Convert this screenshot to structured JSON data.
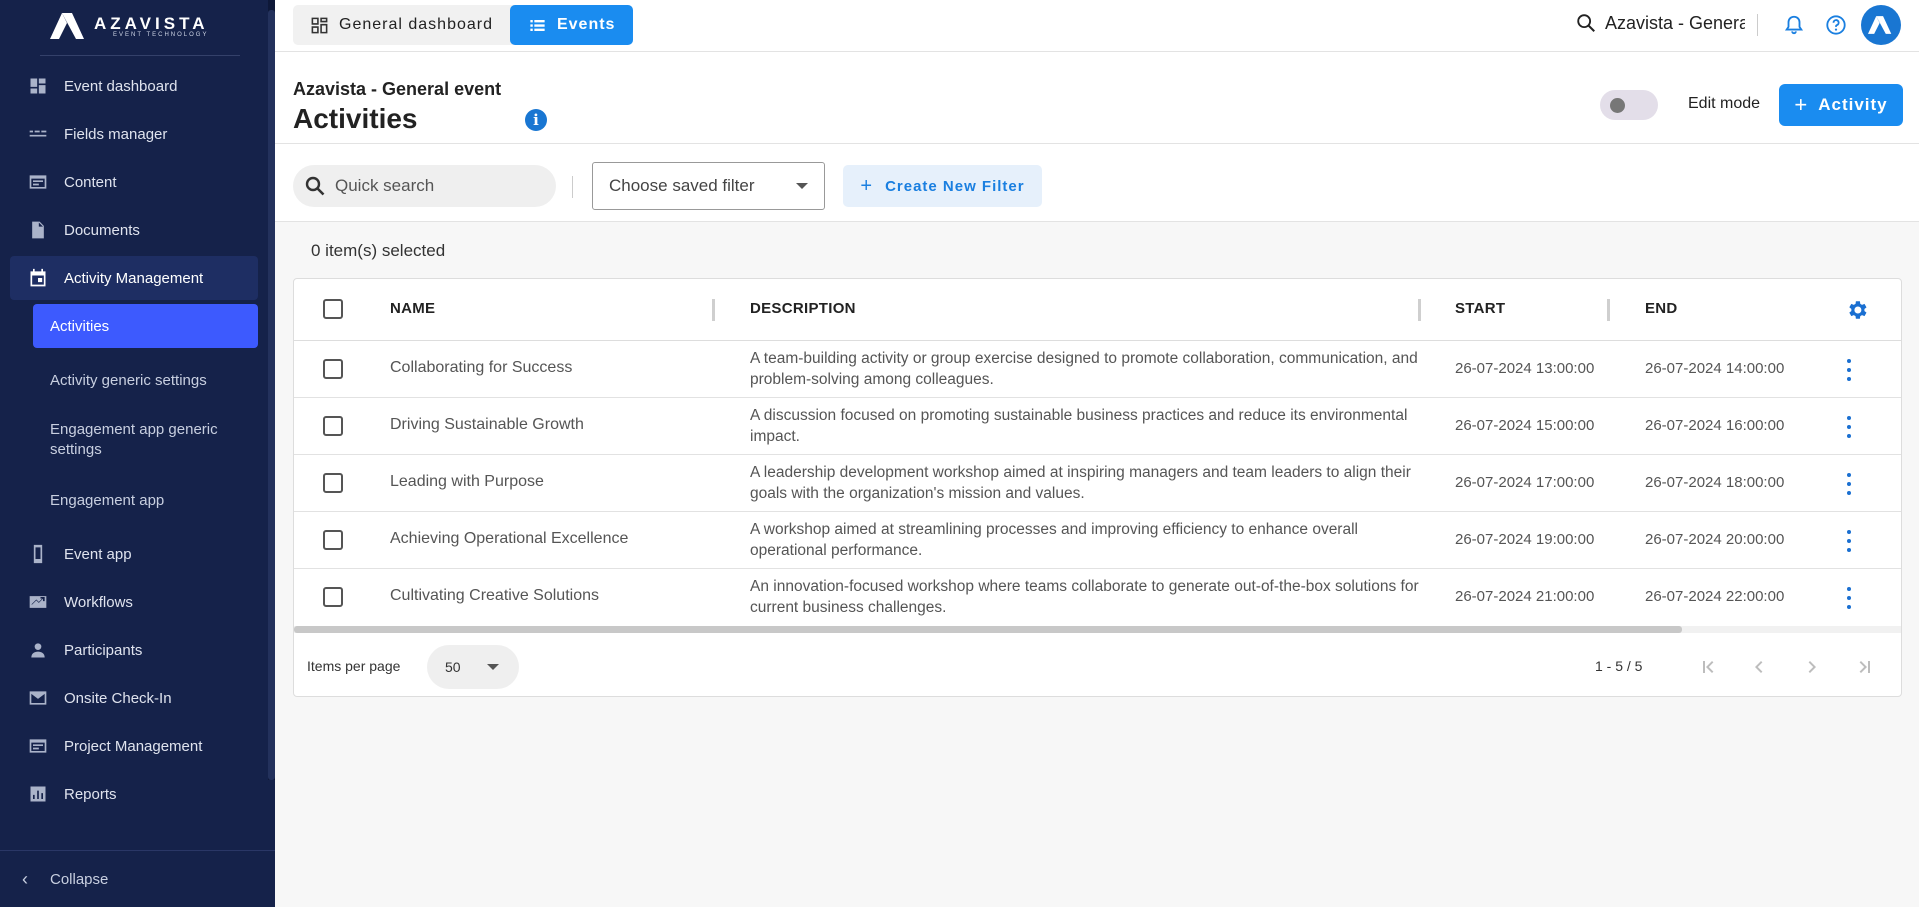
{
  "brand": {
    "name": "AZAVISTA",
    "tagline": "EVENT TECHNOLOGY"
  },
  "sidebar": {
    "items": [
      {
        "label": "Event dashboard",
        "icon": "dashboard-icon"
      },
      {
        "label": "Fields manager",
        "icon": "fields-icon"
      },
      {
        "label": "Content",
        "icon": "content-icon"
      },
      {
        "label": "Documents",
        "icon": "document-icon"
      },
      {
        "label": "Activity Management",
        "icon": "calendar-icon",
        "active": true
      },
      {
        "label": "Event app",
        "icon": "phone-icon"
      },
      {
        "label": "Workflows",
        "icon": "workflow-icon"
      },
      {
        "label": "Participants",
        "icon": "person-icon"
      },
      {
        "label": "Onsite Check-In",
        "icon": "mail-icon"
      },
      {
        "label": "Project Management",
        "icon": "project-icon"
      },
      {
        "label": "Reports",
        "icon": "reports-icon"
      }
    ],
    "sub_items": [
      {
        "label": "Activities",
        "active": true
      },
      {
        "label": "Activity generic settings"
      },
      {
        "label": "Engagement app generic settings"
      },
      {
        "label": "Engagement app"
      }
    ],
    "collapse_label": "Collapse"
  },
  "topbar": {
    "tabs": [
      {
        "label": "General dashboard",
        "icon": "grid-icon"
      },
      {
        "label": "Events",
        "icon": "list-icon",
        "active": true
      }
    ],
    "search_text": "Azavista - General event"
  },
  "header": {
    "event_name": "Azavista - General event",
    "title": "Activities",
    "edit_mode_label": "Edit mode",
    "edit_mode_on": false,
    "add_button_label": "Activity"
  },
  "filters": {
    "quick_search_placeholder": "Quick search",
    "saved_filter_placeholder": "Choose saved filter",
    "create_filter_label": "Create New Filter"
  },
  "selection": {
    "text": "0 item(s) selected"
  },
  "table": {
    "columns": [
      "NAME",
      "DESCRIPTION",
      "START",
      "END"
    ],
    "rows": [
      {
        "name": "Collaborating for Success",
        "description": "A team-building activity or group exercise designed to promote collaboration, communication, and problem-solving among colleagues.",
        "start": "26-07-2024 13:00:00",
        "end": "26-07-2024 14:00:00"
      },
      {
        "name": "Driving Sustainable Growth",
        "description": "A discussion focused on promoting sustainable business practices and reduce its environmental impact.",
        "start": "26-07-2024 15:00:00",
        "end": "26-07-2024 16:00:00"
      },
      {
        "name": "Leading with Purpose",
        "description": "A leadership development workshop aimed at inspiring managers and team leaders to align their goals with the organization's mission and values.",
        "start": "26-07-2024 17:00:00",
        "end": "26-07-2024 18:00:00"
      },
      {
        "name": "Achieving Operational Excellence",
        "description": "A workshop aimed at streamlining processes and improving efficiency to enhance overall operational performance.",
        "start": "26-07-2024 19:00:00",
        "end": "26-07-2024 20:00:00"
      },
      {
        "name": "Cultivating Creative Solutions",
        "description": "An innovation-focused workshop where teams collaborate to generate out-of-the-box solutions for current business challenges.",
        "start": "26-07-2024 21:00:00",
        "end": "26-07-2024 22:00:00"
      }
    ]
  },
  "pagination": {
    "items_per_page_label": "Items per page",
    "items_per_page": "50",
    "range": "1 - 5 / 5"
  },
  "colors": {
    "sidebar_bg": "#15224a",
    "accent": "#1a8cf0",
    "active_sub": "#3d5afe"
  }
}
